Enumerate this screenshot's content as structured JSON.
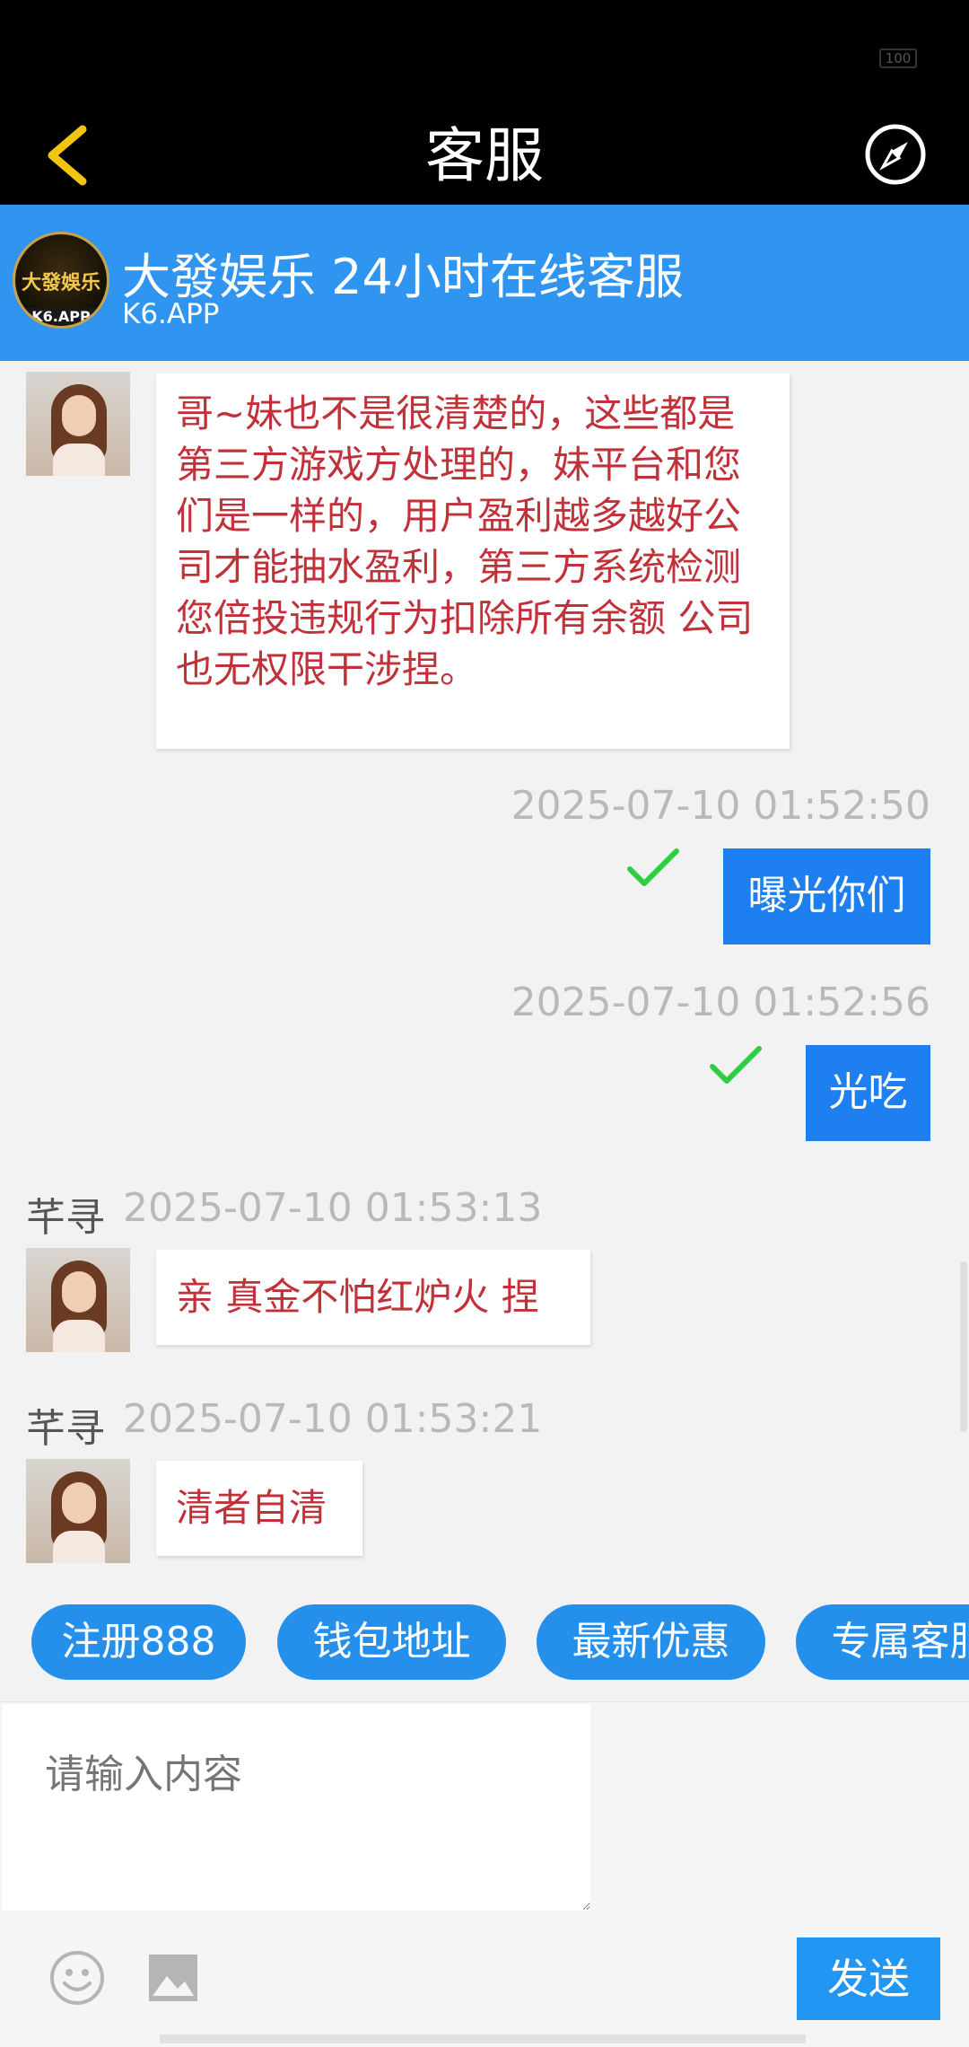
{
  "status_bar": {
    "battery": "100"
  },
  "nav": {
    "title": "客服",
    "back_icon": "chevron-left-icon",
    "compass_icon": "compass-icon"
  },
  "brand": {
    "logo_text": "大發娛乐",
    "logo_sub": "K6.APP",
    "title": "大發娱乐 24小时在线客服",
    "subtitle": "K6.APP"
  },
  "messages": [
    {
      "type": "in",
      "text": "哥~妹也不是很清楚的，这些都是第三方游戏方处理的，妹平台和您们是一样的，用户盈利越多越好公司才能抽水盈利，第三方系统检测您倍投违规行为扣除所有余额  公司也无权限干涉捏。"
    },
    {
      "type": "out",
      "timestamp": "2025-07-10 01:52:50",
      "text": "曝光你们"
    },
    {
      "type": "out",
      "timestamp": "2025-07-10 01:52:56",
      "text": "光吃"
    },
    {
      "type": "in",
      "sender": "芊寻",
      "timestamp": "2025-07-10 01:53:13",
      "text": "亲 真金不怕红炉火 捏"
    },
    {
      "type": "in",
      "sender": "芊寻",
      "timestamp": "2025-07-10 01:53:21",
      "text": "清者自清"
    }
  ],
  "quick_replies": [
    "注册888",
    "钱包地址",
    "最新优惠",
    "专属客服"
  ],
  "composer": {
    "placeholder": "请输入内容",
    "send_label": "发送",
    "emoji_icon": "emoji-icon",
    "image_icon": "image-icon"
  },
  "colors": {
    "nav_bg": "#000000",
    "brand_bg": "#2f95f0",
    "out_bubble": "#1e7ff0",
    "in_text": "#c0313a",
    "check": "#2ecc40",
    "chip": "#2590ec"
  }
}
